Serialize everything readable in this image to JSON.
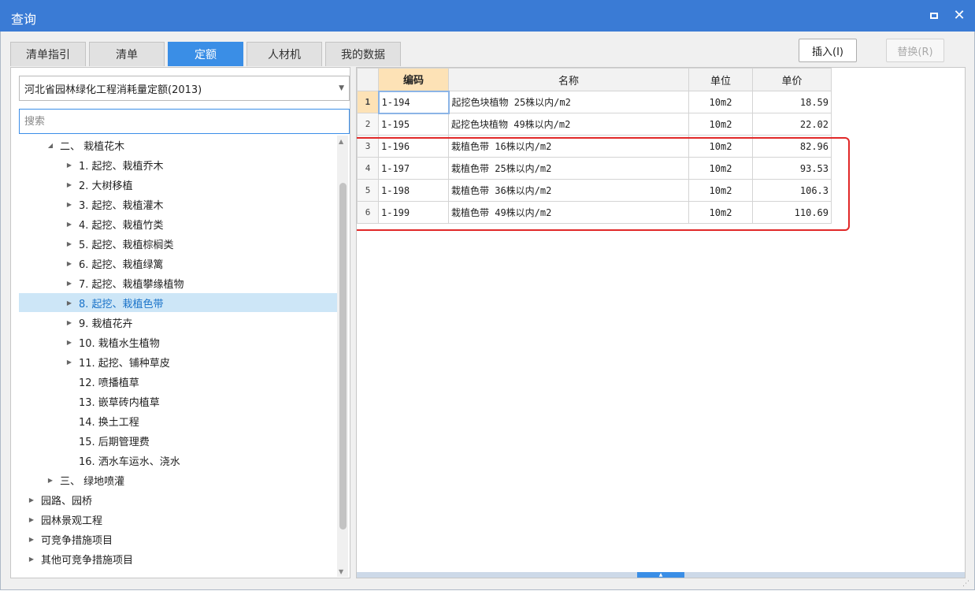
{
  "window": {
    "title": "查询"
  },
  "tabs": [
    {
      "label": "清单指引",
      "active": false
    },
    {
      "label": "清单",
      "active": false
    },
    {
      "label": "定额",
      "active": true
    },
    {
      "label": "人材机",
      "active": false
    },
    {
      "label": "我的数据",
      "active": false
    }
  ],
  "actions": {
    "insert_label": "插入(I)",
    "replace_label": "替换(R)"
  },
  "library": {
    "selected": "河北省园林绿化工程消耗量定额(2013)"
  },
  "search": {
    "placeholder": "搜索"
  },
  "tree": [
    {
      "label": "二、 栽植花木",
      "arrow": "◢",
      "indent": 1
    },
    {
      "label": "1. 起挖、栽植乔木",
      "arrow": "▶",
      "indent": 2
    },
    {
      "label": "2. 大树移植",
      "arrow": "▶",
      "indent": 2
    },
    {
      "label": "3. 起挖、栽植灌木",
      "arrow": "▶",
      "indent": 2
    },
    {
      "label": "4. 起挖、栽植竹类",
      "arrow": "▶",
      "indent": 2
    },
    {
      "label": "5. 起挖、栽植棕榈类",
      "arrow": "▶",
      "indent": 2
    },
    {
      "label": "6. 起挖、栽植绿篱",
      "arrow": "▶",
      "indent": 2
    },
    {
      "label": "7. 起挖、栽植攀缘植物",
      "arrow": "▶",
      "indent": 2
    },
    {
      "label": "8. 起挖、栽植色带",
      "arrow": "▶",
      "indent": 2,
      "selected": true
    },
    {
      "label": "9. 栽植花卉",
      "arrow": "▶",
      "indent": 2
    },
    {
      "label": "10. 栽植水生植物",
      "arrow": "▶",
      "indent": 2
    },
    {
      "label": "11. 起挖、铺种草皮",
      "arrow": "▶",
      "indent": 2
    },
    {
      "label": "12. 喷播植草",
      "arrow": "",
      "indent": 2
    },
    {
      "label": "13. 嵌草砖内植草",
      "arrow": "",
      "indent": 2
    },
    {
      "label": "14. 换土工程",
      "arrow": "",
      "indent": 2
    },
    {
      "label": "15. 后期管理费",
      "arrow": "",
      "indent": 2
    },
    {
      "label": "16. 洒水车运水、浇水",
      "arrow": "",
      "indent": 2
    },
    {
      "label": "三、 绿地喷灌",
      "arrow": "▶",
      "indent": 1
    },
    {
      "label": "园路、园桥",
      "arrow": "▶",
      "indent": 0
    },
    {
      "label": "园林景观工程",
      "arrow": "▶",
      "indent": 0
    },
    {
      "label": "可竞争措施项目",
      "arrow": "▶",
      "indent": 0
    },
    {
      "label": "其他可竞争措施项目",
      "arrow": "▶",
      "indent": 0
    }
  ],
  "grid": {
    "headers": {
      "code": "编码",
      "name": "名称",
      "unit": "单位",
      "price": "单价"
    },
    "rows": [
      {
        "num": "1",
        "code": "1-194",
        "name": "起挖色块植物 25株以内/m2",
        "unit": "10m2",
        "price": "18.59"
      },
      {
        "num": "2",
        "code": "1-195",
        "name": "起挖色块植物 49株以内/m2",
        "unit": "10m2",
        "price": "22.02"
      },
      {
        "num": "3",
        "code": "1-196",
        "name": "栽植色带 16株以内/m2",
        "unit": "10m2",
        "price": "82.96"
      },
      {
        "num": "4",
        "code": "1-197",
        "name": "栽植色带 25株以内/m2",
        "unit": "10m2",
        "price": "93.53"
      },
      {
        "num": "5",
        "code": "1-198",
        "name": "栽植色带 36株以内/m2",
        "unit": "10m2",
        "price": "106.3"
      },
      {
        "num": "6",
        "code": "1-199",
        "name": "栽植色带 49株以内/m2",
        "unit": "10m2",
        "price": "110.69"
      }
    ]
  },
  "colors": {
    "accent": "#3a8ee6",
    "titlebar": "#3a7bd5",
    "highlight": "#e12828",
    "selected_row": "#cde6f7"
  }
}
